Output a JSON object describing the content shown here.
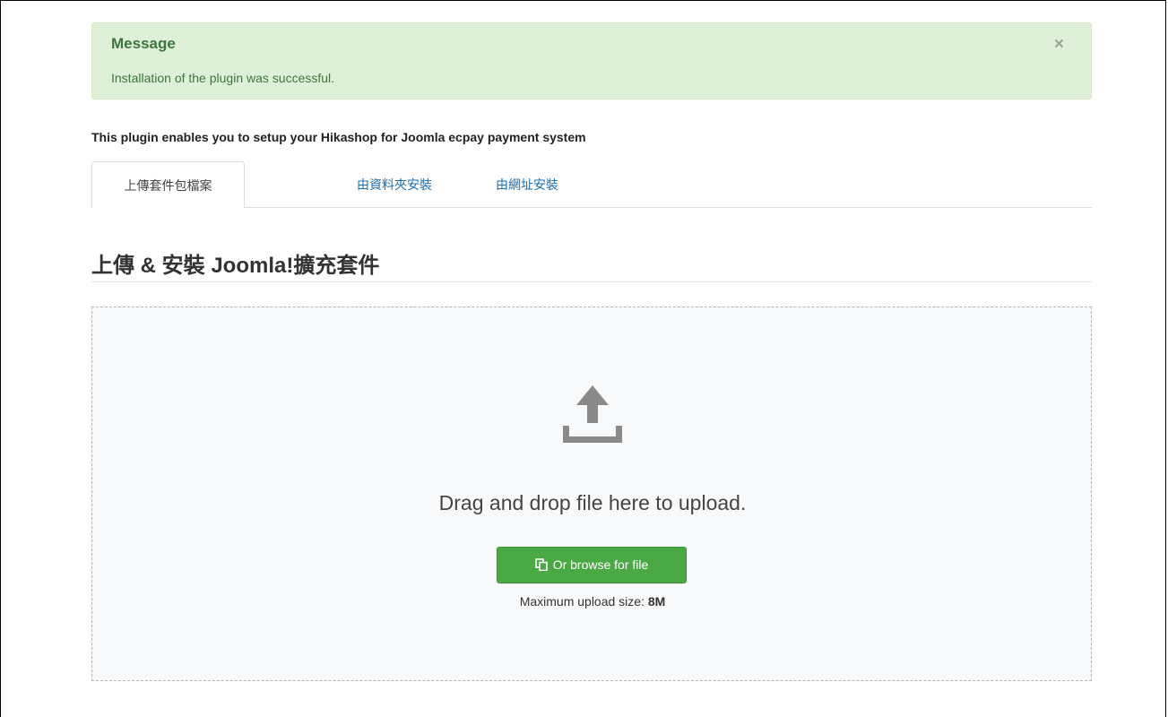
{
  "alert": {
    "heading": "Message",
    "text": "Installation of the plugin was successful.",
    "close_label": "×",
    "color": "#3c763d",
    "background": "#dff0d8"
  },
  "description": "This plugin enables you to setup your Hikashop for Joomla ecpay payment system",
  "tabs": [
    {
      "label": "上傳套件包檔案",
      "active": true
    },
    {
      "label": "由資料夾安裝",
      "active": false
    },
    {
      "label": "由網址安裝",
      "active": false
    }
  ],
  "section": {
    "title": "上傳 & 安裝 Joomla!擴充套件"
  },
  "dropzone": {
    "icon": "upload-icon",
    "text": "Drag and drop file here to upload.",
    "browse_label": "Or browse for file",
    "browse_icon": "copy-files-icon",
    "max_size_label": "Maximum upload size:",
    "max_size_value": "8M",
    "button_color": "#4aa845"
  }
}
